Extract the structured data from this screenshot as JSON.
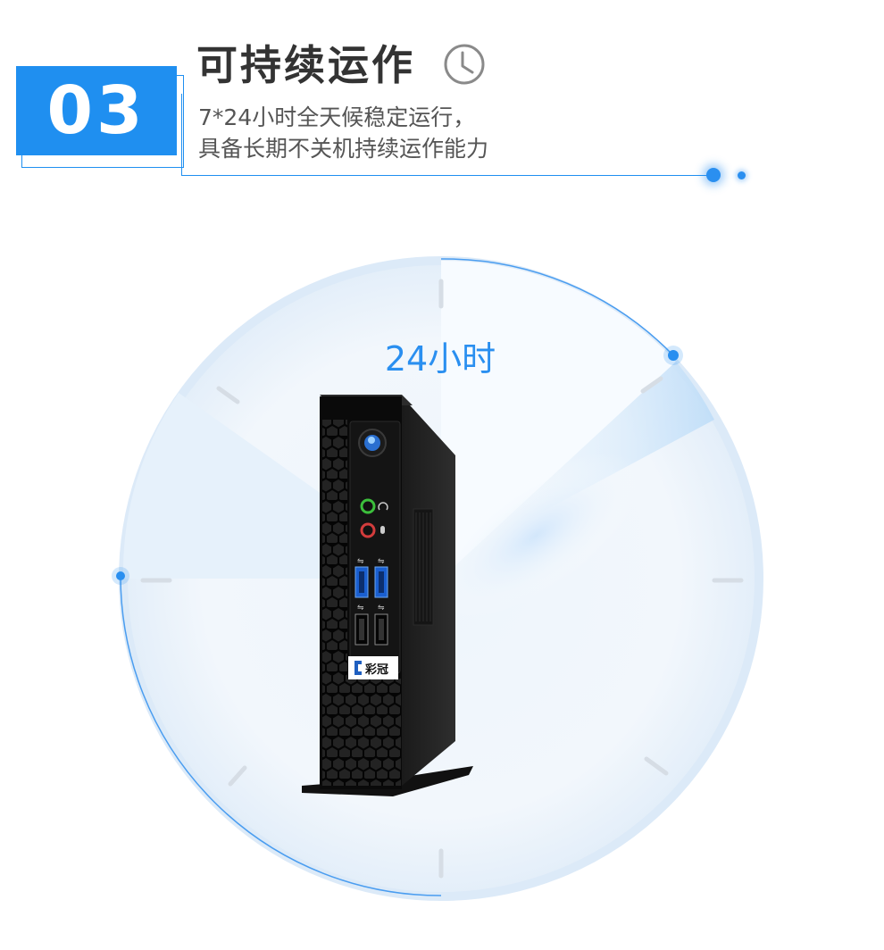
{
  "section": {
    "number": "03",
    "title": "可持续运作",
    "subtitle_line1": "7*24小时全天候稳定运行，",
    "subtitle_line2": "具备长期不关机持续运作能力"
  },
  "dial": {
    "label": "24小时"
  },
  "product": {
    "brand_logo_text": "彩冠"
  },
  "colors": {
    "accent": "#1f8ff0",
    "title_text": "#333333",
    "subtitle_text": "#555555",
    "dial_ring": "#4a9df0"
  },
  "icons": [
    "clock-icon",
    "power-button-icon",
    "headphone-icon",
    "microphone-icon",
    "usb-icon"
  ]
}
